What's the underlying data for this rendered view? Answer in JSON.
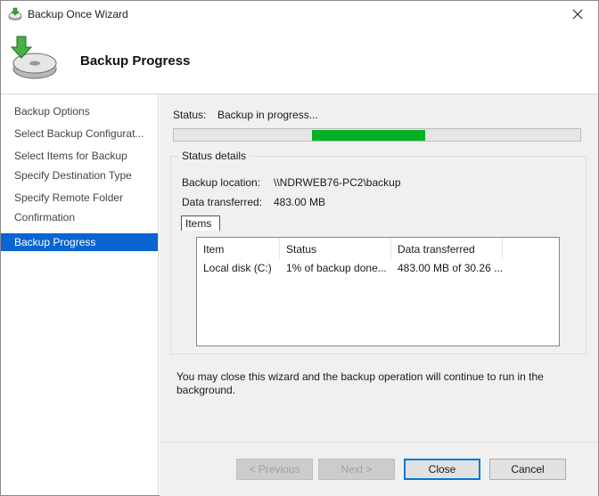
{
  "window": {
    "title": "Backup Once Wizard",
    "icons": {
      "app": "backup-disk-icon",
      "close": "close-icon",
      "wizard": "backup-disk-arrow-icon"
    }
  },
  "header": {
    "heading": "Backup Progress"
  },
  "sidebar": {
    "items": [
      {
        "label": "Backup Options"
      },
      {
        "label": "Select Backup Configurat..."
      },
      {
        "label": "Select Items for Backup"
      },
      {
        "label": "Specify Destination Type"
      },
      {
        "label": "Specify Remote Folder"
      },
      {
        "label": "Confirmation"
      },
      {
        "label": "Backup Progress",
        "active": true
      }
    ]
  },
  "main": {
    "status_label": "Status:",
    "status_value": "Backup in progress...",
    "progress_indeterminate": true,
    "details": {
      "legend": "Status details",
      "location_label": "Backup location:",
      "location_value": "\\\\NDRWEB76-PC2\\backup",
      "transferred_label": "Data transferred:",
      "transferred_value": "483.00 MB",
      "items_tab": "Items",
      "columns": [
        "Item",
        "Status",
        "Data transferred"
      ],
      "rows": [
        {
          "item": "Local disk (C:)",
          "status": "1% of backup done...",
          "data": "483.00 MB of 30.26 ..."
        }
      ]
    },
    "note": "You may close this wizard and the backup operation will continue to run in the background."
  },
  "buttons": {
    "previous": "< Previous",
    "next": "Next >",
    "close": "Close",
    "cancel": "Cancel"
  },
  "colors": {
    "accent": "#0a64d2",
    "progress": "#06b025",
    "panel": "#f0f0f0"
  }
}
